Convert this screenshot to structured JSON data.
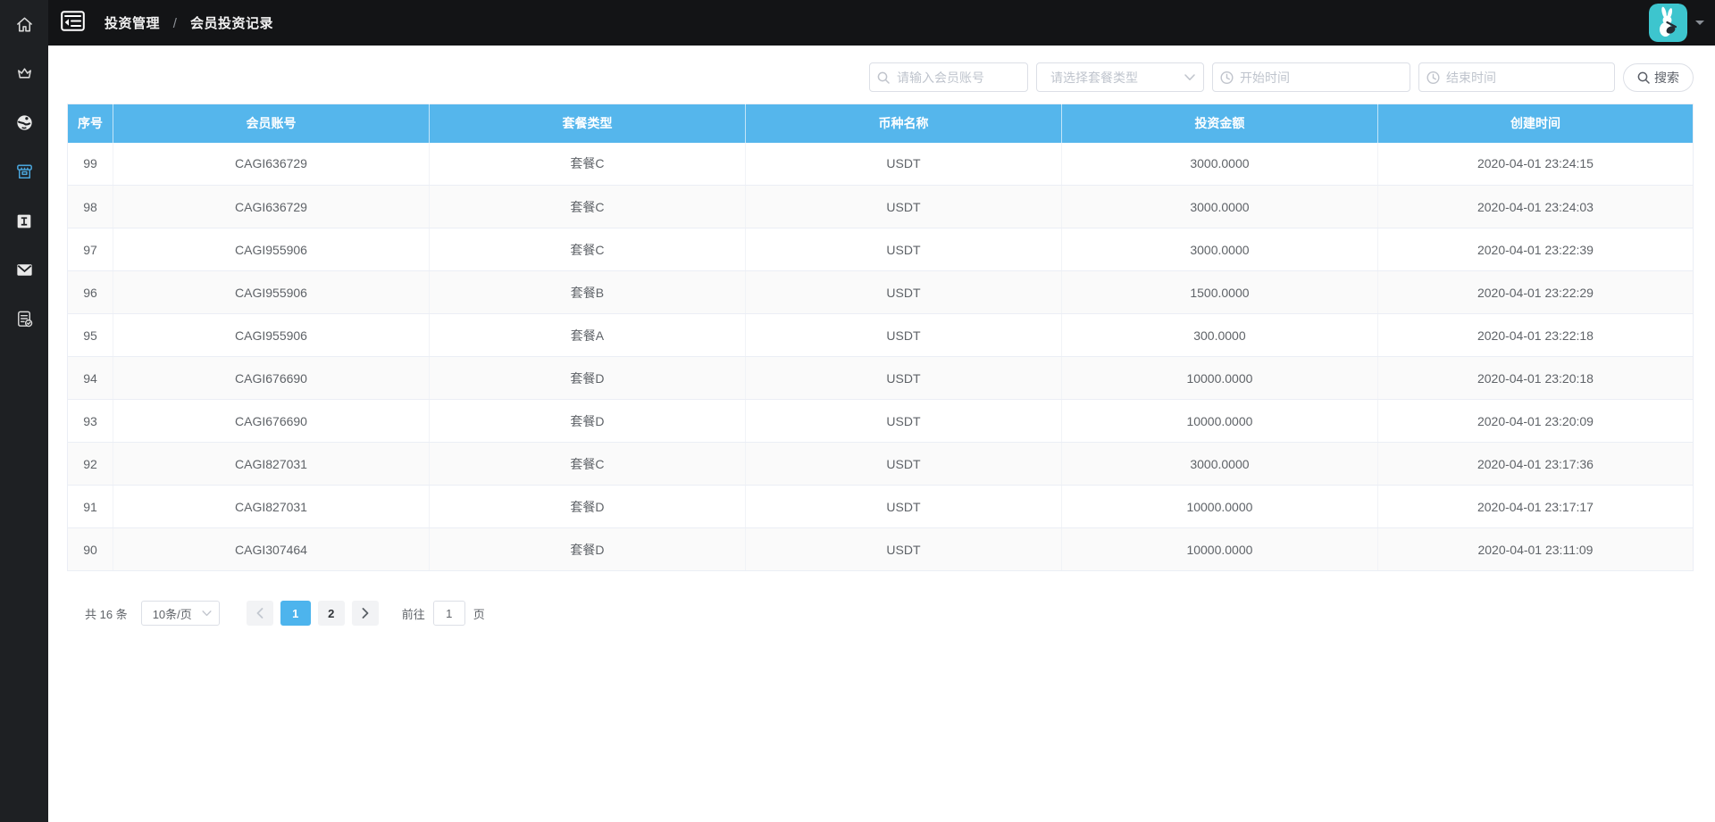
{
  "nav": {
    "breadcrumb": {
      "section": "投资管理",
      "separator": "/",
      "page": "会员投资记录"
    }
  },
  "sidebar": {
    "items": [
      {
        "id": "home",
        "icon": "home-icon",
        "active": false
      },
      {
        "id": "crown",
        "icon": "crown-icon",
        "active": false
      },
      {
        "id": "globe",
        "icon": "globe-icon",
        "active": false
      },
      {
        "id": "invest",
        "icon": "shop-icon",
        "active": true
      },
      {
        "id": "info",
        "icon": "i-square-icon",
        "active": false
      },
      {
        "id": "mail",
        "icon": "mail-icon",
        "active": false
      },
      {
        "id": "report",
        "icon": "document-check-icon",
        "active": false
      }
    ]
  },
  "filters": {
    "account_placeholder": "请输入会员账号",
    "package_placeholder": "请选择套餐类型",
    "start_placeholder": "开始时间",
    "end_placeholder": "结束时间",
    "search_label": "搜索"
  },
  "table": {
    "columns": [
      "序号",
      "会员账号",
      "套餐类型",
      "币种名称",
      "投资金额",
      "创建时间"
    ],
    "rows": [
      [
        "99",
        "CAGI636729",
        "套餐C",
        "USDT",
        "3000.0000",
        "2020-04-01 23:24:15"
      ],
      [
        "98",
        "CAGI636729",
        "套餐C",
        "USDT",
        "3000.0000",
        "2020-04-01 23:24:03"
      ],
      [
        "97",
        "CAGI955906",
        "套餐C",
        "USDT",
        "3000.0000",
        "2020-04-01 23:22:39"
      ],
      [
        "96",
        "CAGI955906",
        "套餐B",
        "USDT",
        "1500.0000",
        "2020-04-01 23:22:29"
      ],
      [
        "95",
        "CAGI955906",
        "套餐A",
        "USDT",
        "300.0000",
        "2020-04-01 23:22:18"
      ],
      [
        "94",
        "CAGI676690",
        "套餐D",
        "USDT",
        "10000.0000",
        "2020-04-01 23:20:18"
      ],
      [
        "93",
        "CAGI676690",
        "套餐D",
        "USDT",
        "10000.0000",
        "2020-04-01 23:20:09"
      ],
      [
        "92",
        "CAGI827031",
        "套餐C",
        "USDT",
        "3000.0000",
        "2020-04-01 23:17:36"
      ],
      [
        "91",
        "CAGI827031",
        "套餐D",
        "USDT",
        "10000.0000",
        "2020-04-01 23:17:17"
      ],
      [
        "90",
        "CAGI307464",
        "套餐D",
        "USDT",
        "10000.0000",
        "2020-04-01 23:11:09"
      ]
    ]
  },
  "pagination": {
    "total": "共 16 条",
    "page_size": "10条/页",
    "pages": [
      "1",
      "2"
    ],
    "active_page": "1",
    "goto_label": "前往",
    "goto_value": "1",
    "goto_suffix": "页"
  },
  "colors": {
    "header_blue": "#55b6ec",
    "active_page_blue": "#4db4ed",
    "avatar_teal": "#3dc5ce",
    "sidebar_active_blue": "#4aa4da",
    "navbar_bg": "#131416",
    "sidebar_bg": "#1e2023"
  }
}
